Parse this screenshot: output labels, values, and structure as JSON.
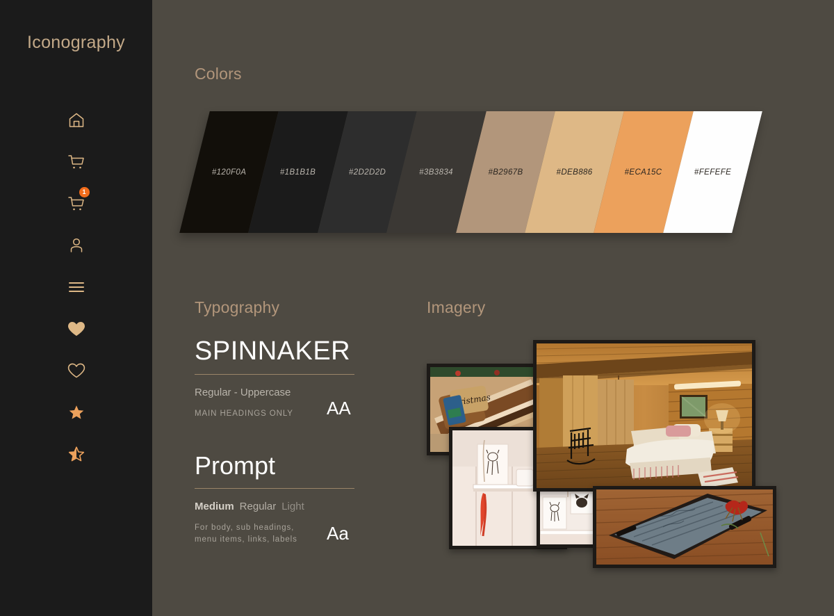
{
  "sidebar": {
    "title": "Iconography",
    "bg_color": "#1B1B1B",
    "icon_color": "#DEB886",
    "icons": [
      {
        "name": "home-icon",
        "label": "Home"
      },
      {
        "name": "shopping-cart-icon",
        "label": "Cart"
      },
      {
        "name": "shopping-cart-badge-icon",
        "label": "Cart with items",
        "badge": "1",
        "badge_color": "#F26C1B"
      },
      {
        "name": "user-icon",
        "label": "Account"
      },
      {
        "name": "hamburger-menu-icon",
        "label": "Menu"
      },
      {
        "name": "heart-filled-icon",
        "label": "Favourite filled"
      },
      {
        "name": "heart-outline-icon",
        "label": "Favourite outline"
      },
      {
        "name": "star-filled-icon",
        "label": "Star filled"
      },
      {
        "name": "star-half-icon",
        "label": "Star half"
      }
    ]
  },
  "page": {
    "background_color": "#4E4A42",
    "heading_color": "#B2967B"
  },
  "colors": {
    "heading": "Colors",
    "swatches": [
      {
        "hex": "#120F0A",
        "label": "#120F0A",
        "text_color": "#B9B4AC"
      },
      {
        "hex": "#1B1B1B",
        "label": "#1B1B1B",
        "text_color": "#B9B4AC"
      },
      {
        "hex": "#2D2D2D",
        "label": "#2D2D2D",
        "text_color": "#B9B4AC"
      },
      {
        "hex": "#3B3834",
        "label": "#3B3834",
        "text_color": "#B9B4AC"
      },
      {
        "hex": "#B2967B",
        "label": "#B2967B",
        "text_color": "#2B2620"
      },
      {
        "hex": "#DEB886",
        "label": "#DEB886",
        "text_color": "#2B2620"
      },
      {
        "hex": "#ECA15C",
        "label": "#ECA15C",
        "text_color": "#2B2620"
      },
      {
        "hex": "#FEFEFE",
        "label": "#FEFEFE",
        "text_color": "#2B2620"
      }
    ]
  },
  "typography": {
    "heading": "Typography",
    "fonts": [
      {
        "name": "SPINNAKER",
        "weights_html": [
          "Regular - Uppercase"
        ],
        "weights_plain": "Regular - Uppercase",
        "usage": "MAIN HEADINGS ONLY",
        "sample": "AA"
      },
      {
        "name": "Prompt",
        "weight_medium": "Medium",
        "weight_regular": "Regular",
        "weight_light": "Light",
        "usage_line1": "For body, sub headings,",
        "usage_line2": "menu items, links, labels",
        "sample": "Aa"
      }
    ]
  },
  "imagery": {
    "heading": "Imagery",
    "photos": [
      {
        "name": "photo-cutting-board",
        "alt": "Wooden cutting boards with Merry Christmas gift tag"
      },
      {
        "name": "photo-cabin-bedroom",
        "alt": "Log cabin bedroom with wooden walls and bed"
      },
      {
        "name": "photo-white-shelf",
        "alt": "White painted wall with shelf, art prints and red feather"
      },
      {
        "name": "photo-small-prints",
        "alt": "Framed animal prints on white wall"
      },
      {
        "name": "photo-wooden-tray",
        "alt": "Rustic blue wooden tray with flowers on hardwood floor"
      }
    ]
  }
}
